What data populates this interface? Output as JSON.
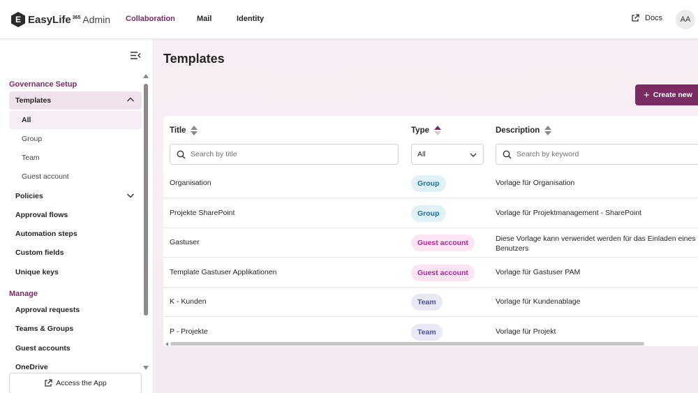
{
  "app": {
    "logo_letter": "E",
    "name": "EasyLife",
    "sup": "365",
    "suffix": "Admin"
  },
  "topnav": [
    {
      "label": "Collaboration",
      "active": true
    },
    {
      "label": "Mail"
    },
    {
      "label": "Identity"
    }
  ],
  "header": {
    "docs_label": "Docs",
    "avatar_initials": "AA"
  },
  "sidebar": {
    "section1": "Governance Setup",
    "templates_label": "Templates",
    "sub_items": [
      "All",
      "Group",
      "Team",
      "Guest account"
    ],
    "policies_label": "Policies",
    "items": [
      "Approval flows",
      "Automation steps",
      "Custom fields",
      "Unique keys"
    ],
    "section2": "Manage",
    "manage_items": [
      "Approval requests",
      "Teams & Groups",
      "Guest accounts",
      "OneDrive"
    ],
    "access_label": "Access the App"
  },
  "page": {
    "title": "Templates",
    "create_label": "Create new"
  },
  "table": {
    "headers": {
      "title": "Title",
      "type": "Type",
      "description": "Description"
    },
    "filters": {
      "title_placeholder": "Search by title",
      "type_value": "All",
      "desc_placeholder": "Search by keyword"
    },
    "rows": [
      {
        "title": "Organisation",
        "type": "Group",
        "description": "Vorlage für Organisation"
      },
      {
        "title": "Projekte SharePoint",
        "type": "Group",
        "description": "Vorlage für Projektmanagement - SharePoint"
      },
      {
        "title": "Gastuser",
        "type": "Guest account",
        "description": "Diese Vorlage kann verwendet werden für das Einladen eines G Benutzers"
      },
      {
        "title": "Template Gastuser Applikationen",
        "type": "Guest account",
        "description": "Vorlage für Gastuser PAM"
      },
      {
        "title": "K - Kunden",
        "type": "Team",
        "description": "Vorlage für Kundenablage"
      },
      {
        "title": "P - Projekte",
        "type": "Team",
        "description": "Vorlage für Projekt"
      }
    ]
  },
  "colors": {
    "accent": "#7a2b64",
    "group_badge": "#e0f1f8",
    "guest_badge": "#fbe5f4",
    "team_badge": "#e9e9f6"
  }
}
